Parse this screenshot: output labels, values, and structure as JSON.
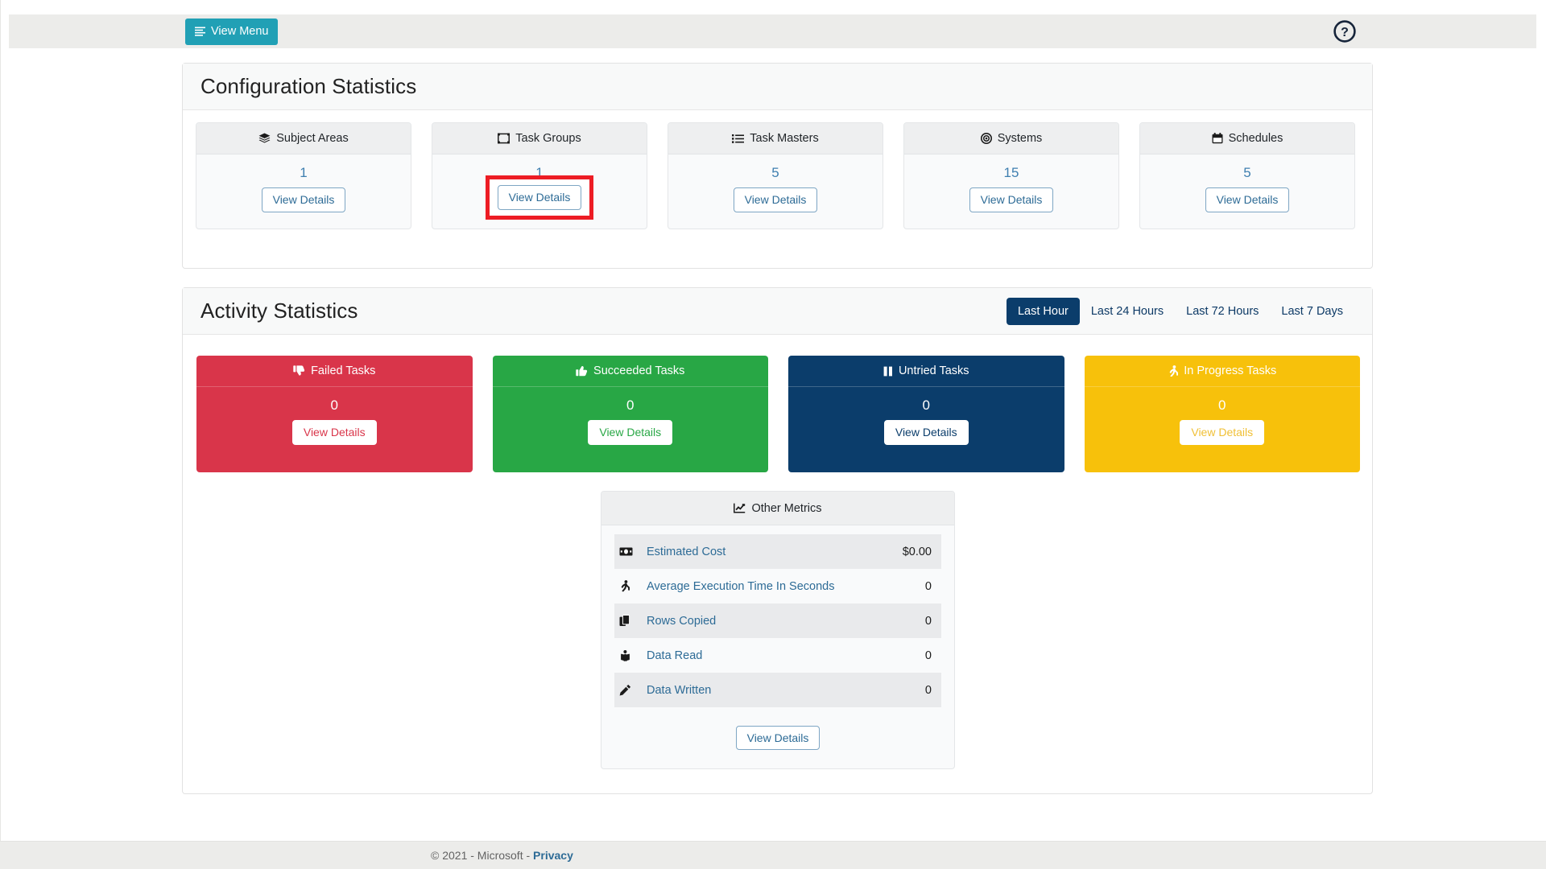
{
  "topbar": {
    "view_menu_label": "View Menu",
    "menu_icon": "hamburger-icon",
    "help_icon": "help-circle-icon",
    "brand_color": "#21a0b5"
  },
  "config_section": {
    "title": "Configuration Statistics",
    "cards": [
      {
        "label": "Subject Areas",
        "icon": "layers-icon",
        "count": "1",
        "button": "View Details",
        "highlighted": false
      },
      {
        "label": "Task Groups",
        "icon": "object-group-icon",
        "count": "1",
        "button": "View Details",
        "highlighted": true
      },
      {
        "label": "Task Masters",
        "icon": "list-icon",
        "count": "5",
        "button": "View Details",
        "highlighted": false
      },
      {
        "label": "Systems",
        "icon": "bullseye-icon",
        "count": "15",
        "button": "View Details",
        "highlighted": false
      },
      {
        "label": "Schedules",
        "icon": "calendar-icon",
        "count": "5",
        "button": "View Details",
        "highlighted": false
      }
    ]
  },
  "activity_section": {
    "title": "Activity Statistics",
    "ranges": [
      {
        "label": "Last Hour",
        "active": true
      },
      {
        "label": "Last 24 Hours",
        "active": false
      },
      {
        "label": "Last 72 Hours",
        "active": false
      },
      {
        "label": "Last 7 Days",
        "active": false
      }
    ],
    "task_cards": [
      {
        "label": "Failed Tasks",
        "icon": "thumbs-down-icon",
        "count": "0",
        "button": "View Details",
        "color": "#d9354a",
        "text_color": "#d9354a"
      },
      {
        "label": "Succeeded Tasks",
        "icon": "thumbs-up-icon",
        "count": "0",
        "button": "View Details",
        "color": "#28a745",
        "text_color": "#28a745"
      },
      {
        "label": "Untried Tasks",
        "icon": "pause-icon",
        "count": "0",
        "button": "View Details",
        "color": "#0b3d6b",
        "text_color": "#0b3d6b"
      },
      {
        "label": "In Progress Tasks",
        "icon": "running-icon",
        "count": "0",
        "button": "View Details",
        "color": "#f7c10b",
        "text_color": "#f0c036"
      }
    ],
    "metrics": {
      "title": "Other Metrics",
      "title_icon": "chart-line-icon",
      "rows": [
        {
          "icon": "money-bill-icon",
          "label": "Estimated Cost",
          "value": "$0.00"
        },
        {
          "icon": "running-icon",
          "label": "Average Execution Time In Seconds",
          "value": "0"
        },
        {
          "icon": "copy-icon",
          "label": "Rows Copied",
          "value": "0"
        },
        {
          "icon": "book-reader-icon",
          "label": "Data Read",
          "value": "0"
        },
        {
          "icon": "pencil-icon",
          "label": "Data Written",
          "value": "0"
        }
      ],
      "button": "View Details"
    }
  },
  "footer": {
    "copyright": "© 2021 - Microsoft - ",
    "privacy_label": "Privacy"
  }
}
